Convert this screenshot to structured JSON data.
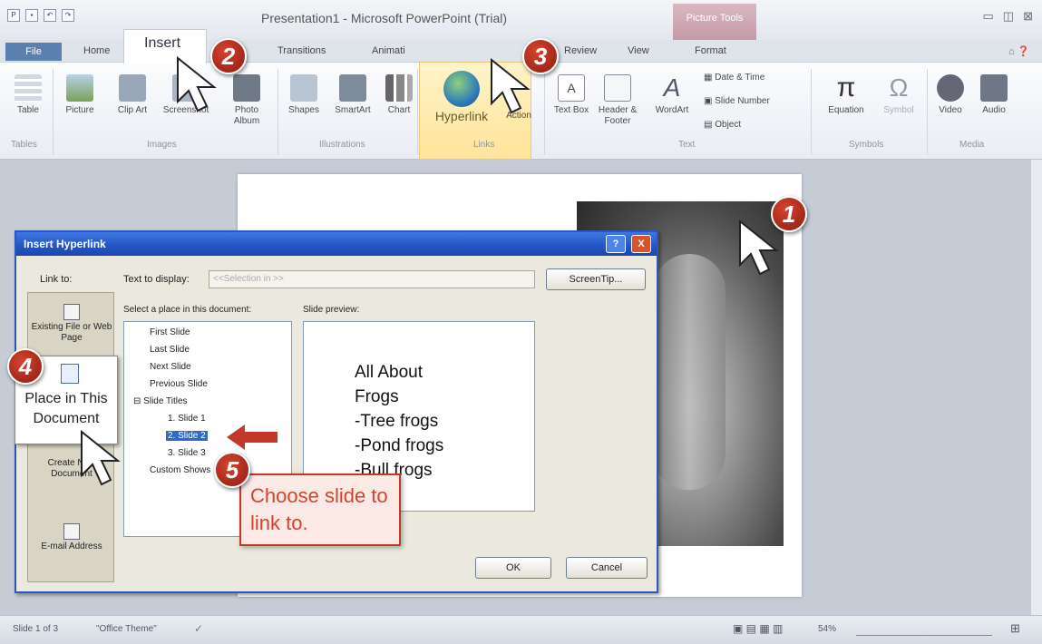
{
  "window": {
    "title": "Presentation1 - Microsoft PowerPoint (Trial)",
    "context_tools": "Picture Tools"
  },
  "tabs": [
    "File",
    "Home",
    "Insert",
    "Transitions",
    "Animati",
    "Review",
    "View",
    "Format"
  ],
  "ribbon": {
    "buttons": [
      "Table",
      "Picture",
      "Clip Art",
      "Screenshot",
      "Photo Album",
      "Shapes",
      "SmartArt",
      "Chart",
      "Hyperlink",
      "Action",
      "Text Box",
      "Header & Footer",
      "WordArt",
      "Equation",
      "Symbol",
      "Video",
      "Audio"
    ],
    "small_buttons": [
      "Date & Time",
      "Slide Number",
      "Object"
    ],
    "groups": [
      "Tables",
      "Images",
      "Illustrations",
      "Links",
      "Text",
      "Symbols",
      "Media"
    ]
  },
  "dialog": {
    "title": "Insert Hyperlink",
    "link_to_label": "Link to:",
    "text_to_display_label": "Text to display:",
    "text_to_display_value": "<<Selection in >>",
    "screentip_button": "ScreenTip...",
    "select_place_label": "Select a place in this document:",
    "slide_preview_label": "Slide preview:",
    "link_options": [
      "Existing File or Web Page",
      "Place in This Document",
      "Create New Document",
      "E-mail Address"
    ],
    "tree": [
      "First Slide",
      "Last Slide",
      "Next Slide",
      "Previous Slide",
      "Slide Titles",
      "1. Slide 1",
      "2. Slide 2",
      "3. Slide 3",
      "Custom Shows"
    ],
    "preview_text": "All About\nFrogs\n-Tree frogs\n-Pond frogs\n-Bull frogs",
    "ok": "OK",
    "cancel": "Cancel",
    "help": "?",
    "close": "X"
  },
  "callouts": {
    "place_in_document": "Place in This Document",
    "note": "Choose slide to link to.",
    "steps": [
      "1",
      "2",
      "3",
      "4",
      "5"
    ]
  },
  "statusbar": {
    "slide": "Slide 1 of 3",
    "theme": "\"Office Theme\"",
    "zoom": "54%"
  },
  "colors": {
    "dialog_title": "#2454c4",
    "callout_red": "#c0392b",
    "links_highlight": "#ffe49a"
  }
}
